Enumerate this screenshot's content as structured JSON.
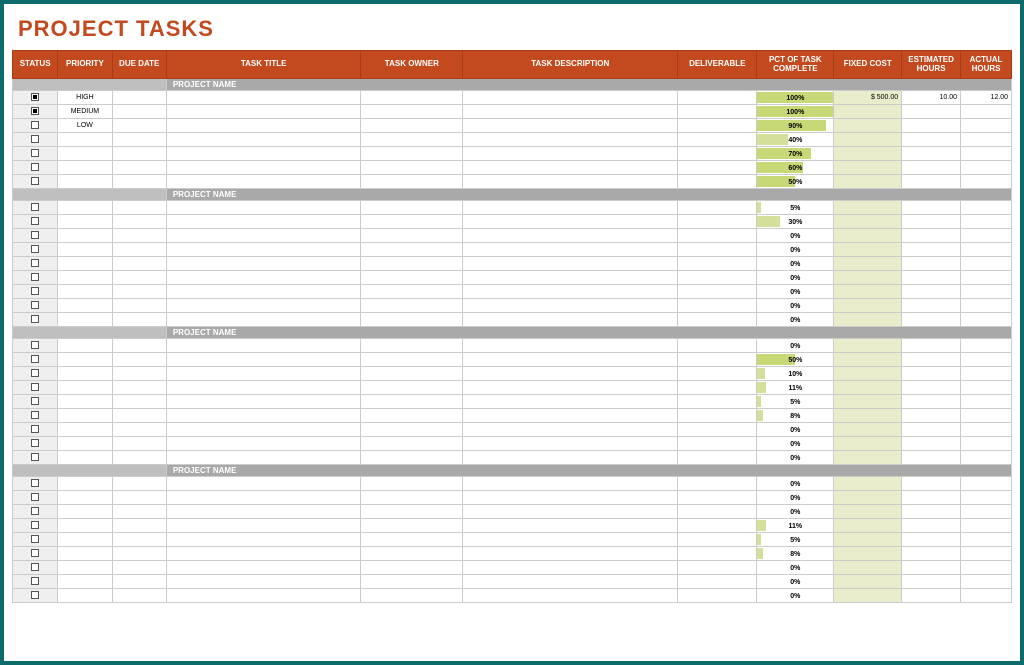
{
  "title": "PROJECT TASKS",
  "columns": {
    "status": "STATUS",
    "priority": "PRIORITY",
    "due_date": "DUE DATE",
    "task_title": "TASK TITLE",
    "task_owner": "TASK OWNER",
    "task_description": "TASK DESCRIPTION",
    "deliverable": "DELIVERABLE",
    "pct_complete": "PCT OF TASK COMPLETE",
    "fixed_cost": "FIXED COST",
    "est_hours": "ESTIMATED HOURS",
    "act_hours": "ACTUAL HOURS"
  },
  "section_label": "PROJECT NAME",
  "sections": [
    {
      "rows": [
        {
          "checked": true,
          "priority": "HIGH",
          "pct": 100,
          "cost": "$    500.00",
          "est": "10.00",
          "act": "12.00"
        },
        {
          "checked": true,
          "priority": "MEDIUM",
          "pct": 100,
          "cost": "",
          "est": "",
          "act": ""
        },
        {
          "checked": false,
          "priority": "LOW",
          "pct": 90,
          "cost": "",
          "est": "",
          "act": ""
        },
        {
          "checked": false,
          "priority": "",
          "pct": 40,
          "cost": "",
          "est": "",
          "act": ""
        },
        {
          "checked": false,
          "priority": "",
          "pct": 70,
          "cost": "",
          "est": "",
          "act": ""
        },
        {
          "checked": false,
          "priority": "",
          "pct": 60,
          "cost": "",
          "est": "",
          "act": ""
        },
        {
          "checked": false,
          "priority": "",
          "pct": 50,
          "cost": "",
          "est": "",
          "act": ""
        }
      ]
    },
    {
      "rows": [
        {
          "checked": false,
          "priority": "",
          "pct": 5,
          "cost": "",
          "est": "",
          "act": ""
        },
        {
          "checked": false,
          "priority": "",
          "pct": 30,
          "cost": "",
          "est": "",
          "act": ""
        },
        {
          "checked": false,
          "priority": "",
          "pct": 0,
          "cost": "",
          "est": "",
          "act": ""
        },
        {
          "checked": false,
          "priority": "",
          "pct": 0,
          "cost": "",
          "est": "",
          "act": ""
        },
        {
          "checked": false,
          "priority": "",
          "pct": 0,
          "cost": "",
          "est": "",
          "act": ""
        },
        {
          "checked": false,
          "priority": "",
          "pct": 0,
          "cost": "",
          "est": "",
          "act": ""
        },
        {
          "checked": false,
          "priority": "",
          "pct": 0,
          "cost": "",
          "est": "",
          "act": ""
        },
        {
          "checked": false,
          "priority": "",
          "pct": 0,
          "cost": "",
          "est": "",
          "act": ""
        },
        {
          "checked": false,
          "priority": "",
          "pct": 0,
          "cost": "",
          "est": "",
          "act": ""
        }
      ]
    },
    {
      "rows": [
        {
          "checked": false,
          "priority": "",
          "pct": 0,
          "cost": "",
          "est": "",
          "act": ""
        },
        {
          "checked": false,
          "priority": "",
          "pct": 50,
          "cost": "",
          "est": "",
          "act": ""
        },
        {
          "checked": false,
          "priority": "",
          "pct": 10,
          "cost": "",
          "est": "",
          "act": ""
        },
        {
          "checked": false,
          "priority": "",
          "pct": 11,
          "cost": "",
          "est": "",
          "act": ""
        },
        {
          "checked": false,
          "priority": "",
          "pct": 5,
          "cost": "",
          "est": "",
          "act": ""
        },
        {
          "checked": false,
          "priority": "",
          "pct": 8,
          "cost": "",
          "est": "",
          "act": ""
        },
        {
          "checked": false,
          "priority": "",
          "pct": 0,
          "cost": "",
          "est": "",
          "act": ""
        },
        {
          "checked": false,
          "priority": "",
          "pct": 0,
          "cost": "",
          "est": "",
          "act": ""
        },
        {
          "checked": false,
          "priority": "",
          "pct": 0,
          "cost": "",
          "est": "",
          "act": ""
        }
      ]
    },
    {
      "rows": [
        {
          "checked": false,
          "priority": "",
          "pct": 0,
          "cost": "",
          "est": "",
          "act": ""
        },
        {
          "checked": false,
          "priority": "",
          "pct": 0,
          "cost": "",
          "est": "",
          "act": ""
        },
        {
          "checked": false,
          "priority": "",
          "pct": 0,
          "cost": "",
          "est": "",
          "act": ""
        },
        {
          "checked": false,
          "priority": "",
          "pct": 11,
          "cost": "",
          "est": "",
          "act": ""
        },
        {
          "checked": false,
          "priority": "",
          "pct": 5,
          "cost": "",
          "est": "",
          "act": ""
        },
        {
          "checked": false,
          "priority": "",
          "pct": 8,
          "cost": "",
          "est": "",
          "act": ""
        },
        {
          "checked": false,
          "priority": "",
          "pct": 0,
          "cost": "",
          "est": "",
          "act": ""
        },
        {
          "checked": false,
          "priority": "",
          "pct": 0,
          "cost": "",
          "est": "",
          "act": ""
        },
        {
          "checked": false,
          "priority": "",
          "pct": 0,
          "cost": "",
          "est": "",
          "act": ""
        }
      ]
    }
  ]
}
